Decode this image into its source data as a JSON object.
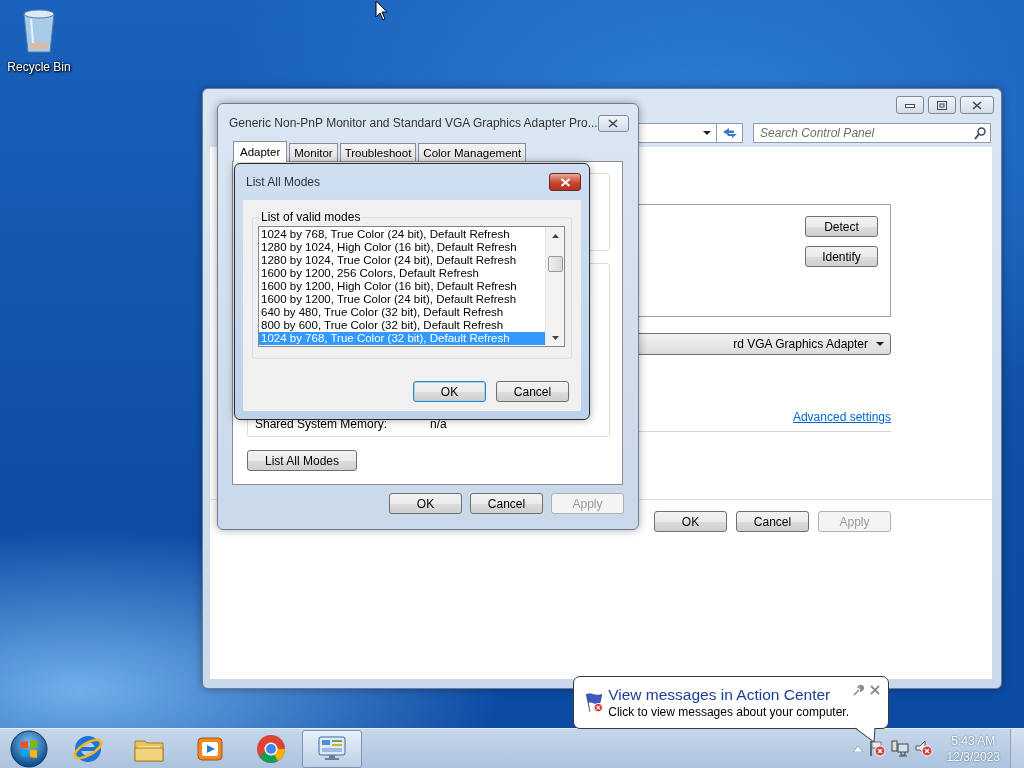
{
  "desktop": {
    "icons": [
      {
        "kind": "recycle_bin",
        "label": "Recycle Bin"
      }
    ]
  },
  "control_panel": {
    "search": {
      "placeholder": "Search Control Panel"
    },
    "group_buttons": [
      {
        "label": "Detect"
      },
      {
        "label": "Identify"
      }
    ],
    "adapter_dropdown": {
      "value": "rd VGA Graphics Adapter"
    },
    "advanced_link": "Advanced settings",
    "buttons": [
      {
        "label": "OK",
        "disabled": false
      },
      {
        "label": "Cancel",
        "disabled": false
      },
      {
        "label": "Apply",
        "disabled": true
      }
    ]
  },
  "properties_dialog": {
    "title": "Generic Non-PnP Monitor and Standard VGA Graphics Adapter Pro...",
    "tabs": [
      {
        "label": "Adapter",
        "selected": true
      },
      {
        "label": "Monitor",
        "selected": false
      },
      {
        "label": "Troubleshoot",
        "selected": false
      },
      {
        "label": "Color Management",
        "selected": false
      }
    ],
    "shared_memory": {
      "label": "Shared System Memory:",
      "value": "n/a"
    },
    "list_all_modes_button": "List All Modes",
    "buttons": [
      {
        "label": "OK",
        "disabled": false
      },
      {
        "label": "Cancel",
        "disabled": false
      },
      {
        "label": "Apply",
        "disabled": true
      }
    ]
  },
  "list_all_modes_dialog": {
    "title": "List All Modes",
    "group_label": "List of valid modes",
    "modes": [
      {
        "label": "1024 by 768, True Color (24 bit), Default Refresh",
        "selected": false
      },
      {
        "label": "1280 by 1024, High Color (16 bit), Default Refresh",
        "selected": false
      },
      {
        "label": "1280 by 1024, True Color (24 bit), Default Refresh",
        "selected": false
      },
      {
        "label": "1600 by 1200, 256 Colors, Default Refresh",
        "selected": false
      },
      {
        "label": "1600 by 1200, High Color (16 bit), Default Refresh",
        "selected": false
      },
      {
        "label": "1600 by 1200, True Color (24 bit), Default Refresh",
        "selected": false
      },
      {
        "label": "640 by 480, True Color (32 bit), Default Refresh",
        "selected": false
      },
      {
        "label": "800 by 600, True Color (32 bit), Default Refresh",
        "selected": false
      },
      {
        "label": "1024 by 768, True Color (32 bit), Default Refresh",
        "selected": true
      }
    ],
    "buttons": [
      {
        "label": "OK",
        "default": true
      },
      {
        "label": "Cancel",
        "default": false
      }
    ]
  },
  "notification": {
    "title": "View messages in Action Center",
    "message": "Click to view messages about your computer."
  },
  "taskbar": {
    "apps": [
      {
        "kind": "ie",
        "active": false
      },
      {
        "kind": "explorer",
        "active": false
      },
      {
        "kind": "media_player",
        "active": false
      },
      {
        "kind": "chrome",
        "active": false
      },
      {
        "kind": "control_panel",
        "active": true
      }
    ],
    "tray": [
      {
        "kind": "show_hidden"
      },
      {
        "kind": "action_center_error"
      },
      {
        "kind": "network"
      },
      {
        "kind": "volume_muted"
      }
    ],
    "clock": {
      "time": "5:43 AM",
      "date": "12/3/2023"
    }
  }
}
